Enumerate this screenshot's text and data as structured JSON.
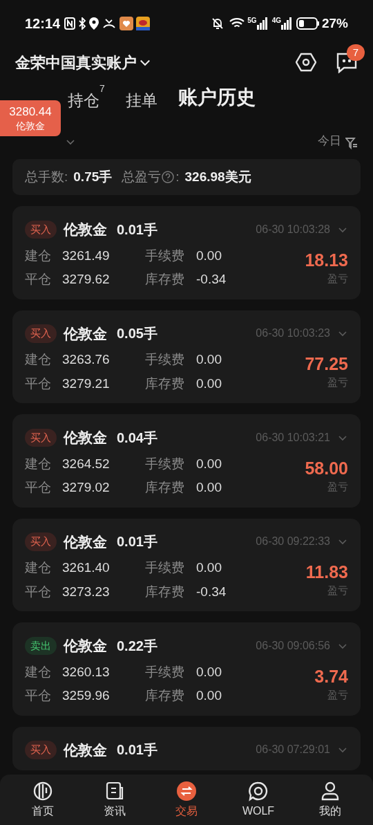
{
  "status_bar": {
    "time": "12:14",
    "network_1": "5G",
    "network_2": "4G",
    "battery": "27%"
  },
  "header": {
    "account": "金荣中国真实账户",
    "message_badge": "7"
  },
  "tabs": [
    {
      "label": "持仓",
      "superscript": "7",
      "selected": false
    },
    {
      "label": "挂单",
      "selected": false
    },
    {
      "label": "账户历史",
      "selected": true
    }
  ],
  "price_badge": {
    "price": "3280.44",
    "symbol": "伦敦金"
  },
  "filter": {
    "date": "今日"
  },
  "summary": {
    "lots_label": "总手数:",
    "lots": "0.75手",
    "pl_label": "总盈亏",
    "pl_colon": ":",
    "pl": "326.98美元"
  },
  "orders": [
    {
      "kind": "buy",
      "side": "买入",
      "symbol": "伦敦金",
      "lots": "0.01手",
      "time": "06-30 10:03:28",
      "open_label": "建仓",
      "open": "3261.49",
      "fee_label": "手续费",
      "fee": "0.00",
      "close_label": "平仓",
      "close": "3279.62",
      "swap_label": "库存费",
      "swap": "-0.34",
      "profit": "18.13",
      "profit_label": "盈亏"
    },
    {
      "kind": "buy",
      "side": "买入",
      "symbol": "伦敦金",
      "lots": "0.05手",
      "time": "06-30 10:03:23",
      "open_label": "建仓",
      "open": "3263.76",
      "fee_label": "手续费",
      "fee": "0.00",
      "close_label": "平仓",
      "close": "3279.21",
      "swap_label": "库存费",
      "swap": "0.00",
      "profit": "77.25",
      "profit_label": "盈亏"
    },
    {
      "kind": "buy",
      "side": "买入",
      "symbol": "伦敦金",
      "lots": "0.04手",
      "time": "06-30 10:03:21",
      "open_label": "建仓",
      "open": "3264.52",
      "fee_label": "手续费",
      "fee": "0.00",
      "close_label": "平仓",
      "close": "3279.02",
      "swap_label": "库存费",
      "swap": "0.00",
      "profit": "58.00",
      "profit_label": "盈亏"
    },
    {
      "kind": "buy",
      "side": "买入",
      "symbol": "伦敦金",
      "lots": "0.01手",
      "time": "06-30 09:22:33",
      "open_label": "建仓",
      "open": "3261.40",
      "fee_label": "手续费",
      "fee": "0.00",
      "close_label": "平仓",
      "close": "3273.23",
      "swap_label": "库存费",
      "swap": "-0.34",
      "profit": "11.83",
      "profit_label": "盈亏"
    },
    {
      "kind": "sell",
      "side": "卖出",
      "symbol": "伦敦金",
      "lots": "0.22手",
      "time": "06-30 09:06:56",
      "open_label": "建仓",
      "open": "3260.13",
      "fee_label": "手续费",
      "fee": "0.00",
      "close_label": "平仓",
      "close": "3259.96",
      "swap_label": "库存费",
      "swap": "0.00",
      "profit": "3.74",
      "profit_label": "盈亏"
    },
    {
      "kind": "buy",
      "side": "买入",
      "symbol": "伦敦金",
      "lots": "0.01手",
      "time": "06-30 07:29:01"
    }
  ],
  "nav": [
    {
      "kind": "home",
      "label": "首页",
      "selected": false
    },
    {
      "kind": "news",
      "label": "资讯",
      "selected": false
    },
    {
      "kind": "trade",
      "label": "交易",
      "selected": true
    },
    {
      "kind": "community",
      "label": "WOLF",
      "selected": false
    },
    {
      "kind": "profile",
      "label": "我的",
      "selected": false
    }
  ]
}
